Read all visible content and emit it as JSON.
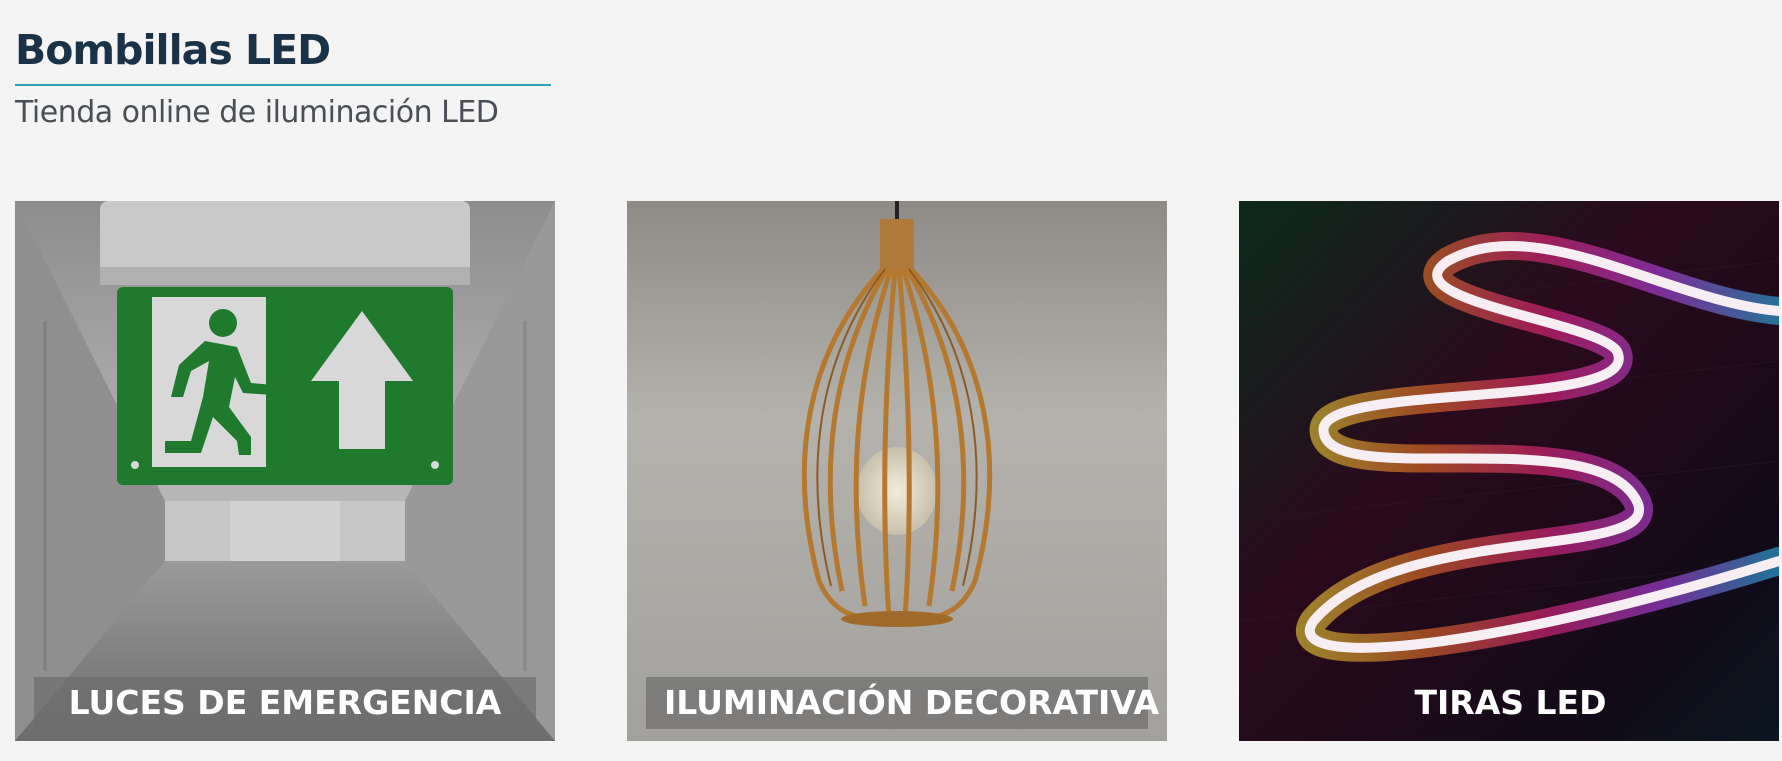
{
  "header": {
    "title": "Bombillas LED",
    "subtitle": "Tienda online de iluminación LED",
    "accent_color": "#2aa3b8"
  },
  "categories": [
    {
      "label": "LUCES DE EMERGENCIA",
      "image": "emergency-exit-sign"
    },
    {
      "label": "ILUMINACIÓN DECORATIVA",
      "image": "wicker-pendant-lamp"
    },
    {
      "label": "TIRAS LED",
      "image": "rgb-led-strip"
    }
  ],
  "colors": {
    "background": "#f4f4f4",
    "title": "#1a3247",
    "subtitle": "#4a4f55",
    "label_bg": "#6e6e6e",
    "exit_sign_green": "#1f7a2e"
  }
}
